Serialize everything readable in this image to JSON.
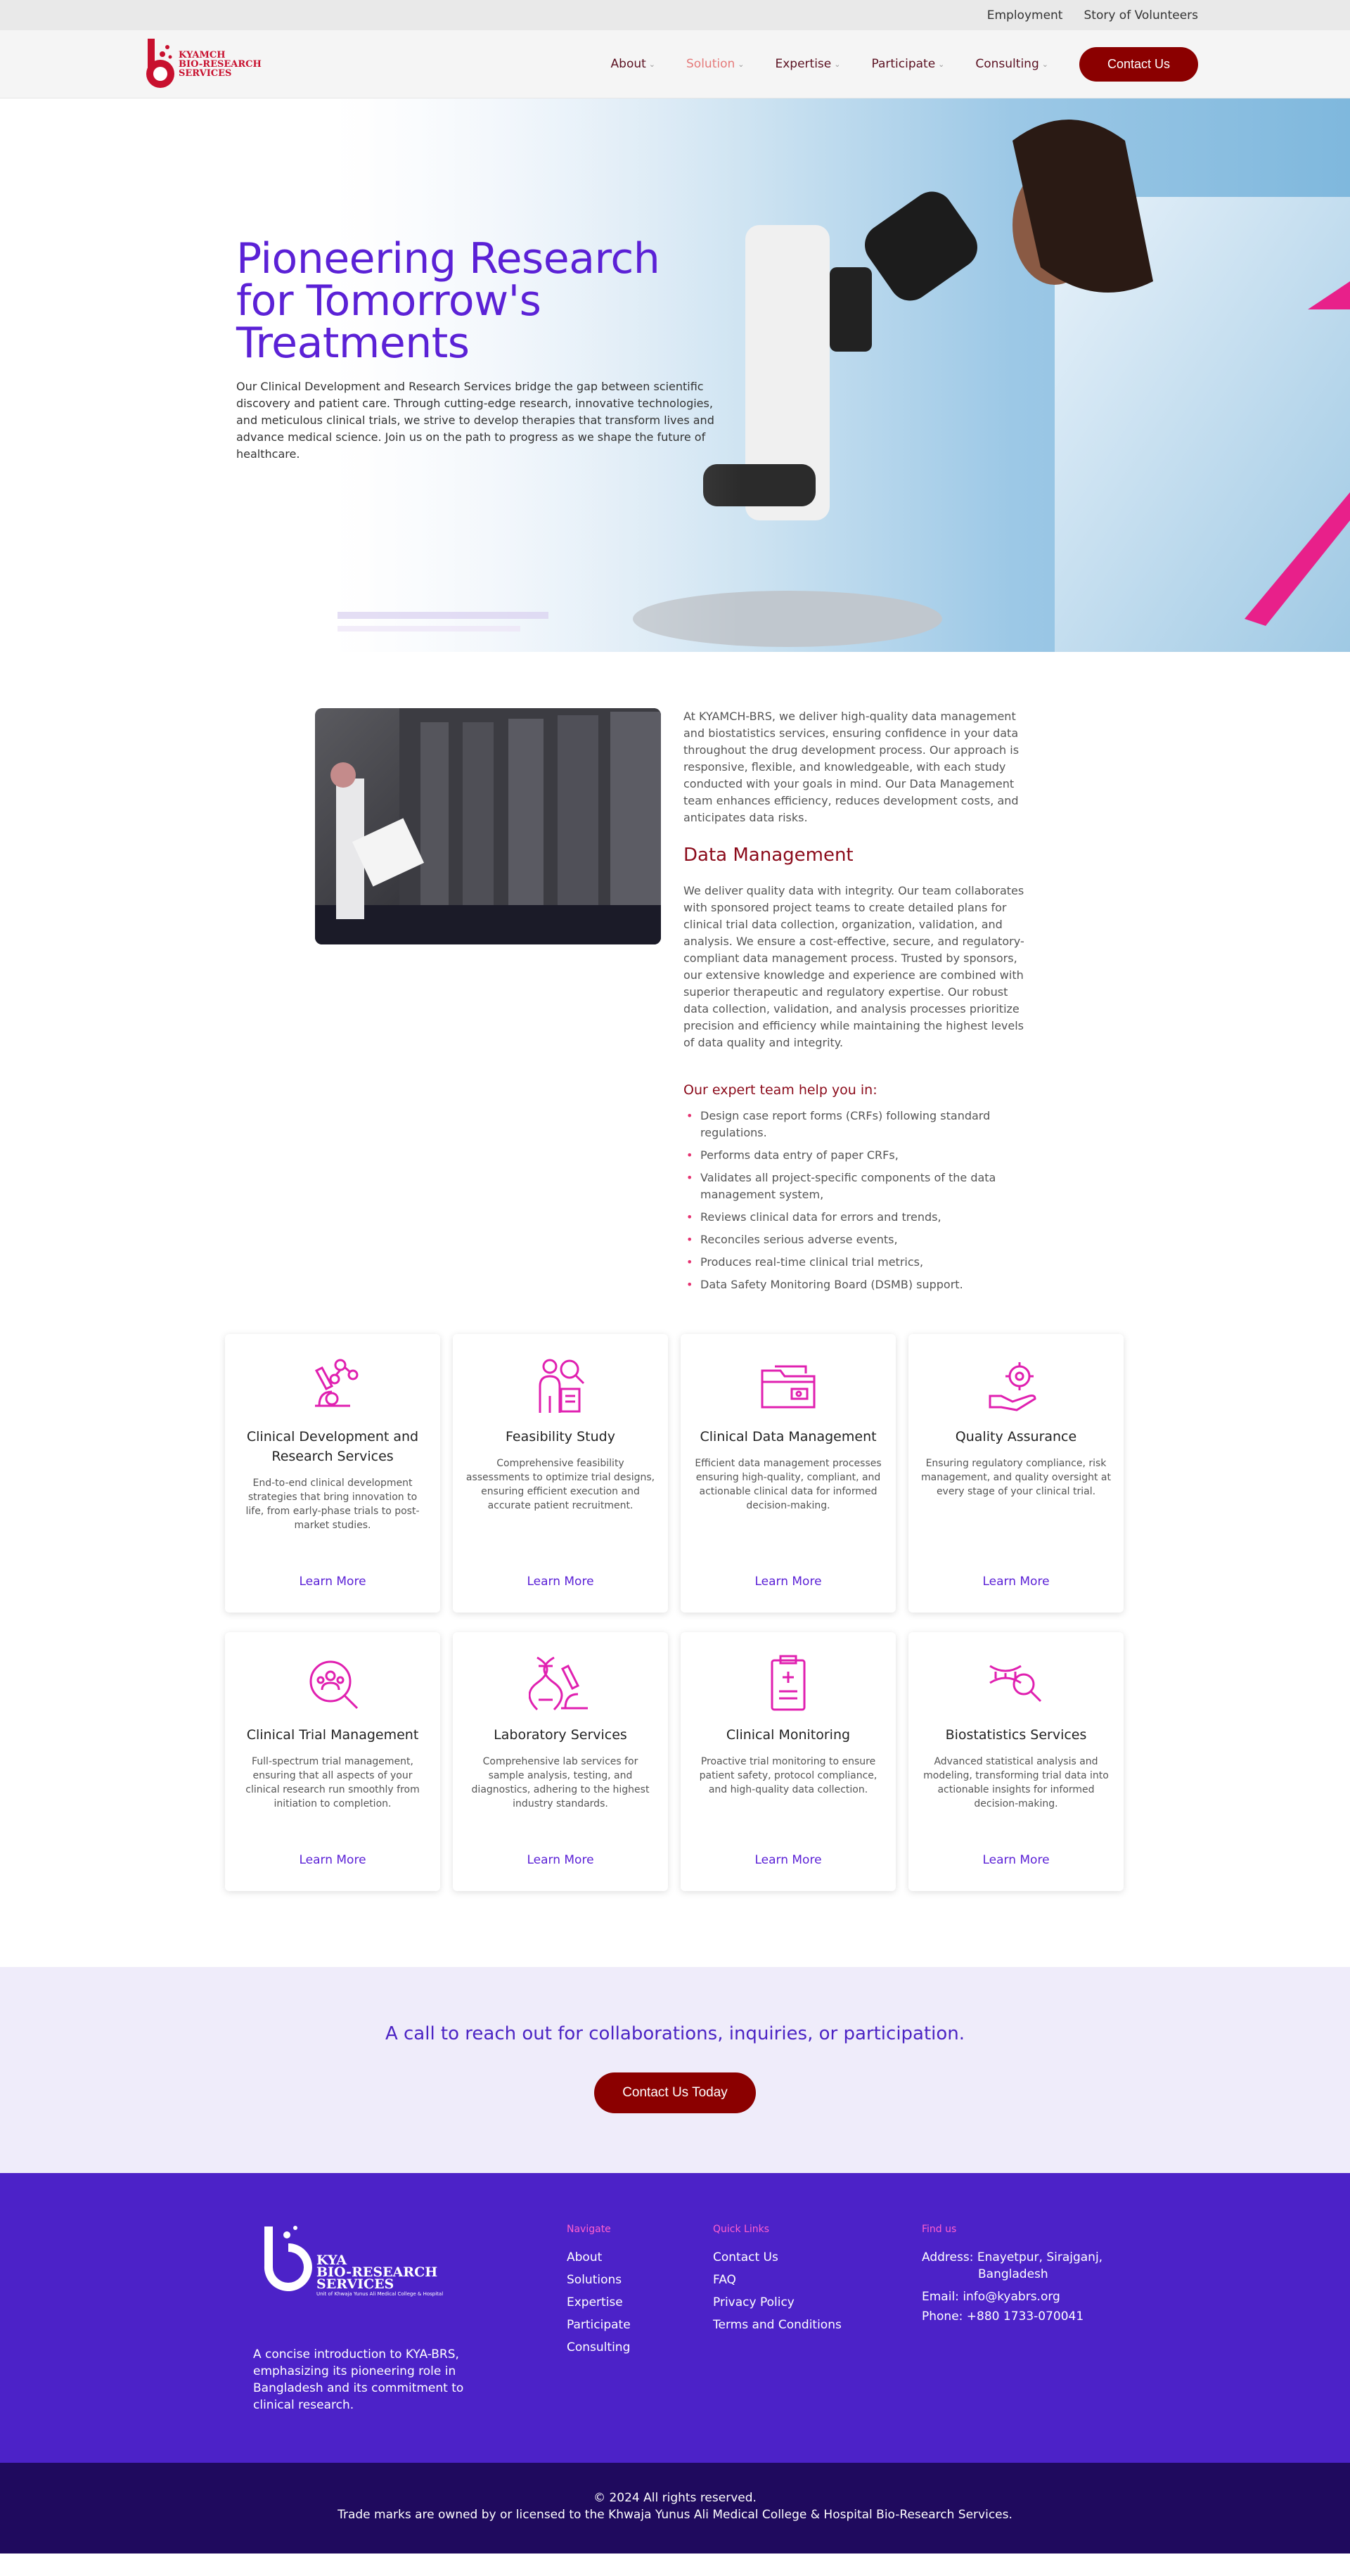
{
  "topbar": {
    "links": [
      "Employment",
      "Story of Volunteers"
    ]
  },
  "header": {
    "logo_text": [
      "KYAMCH",
      "BIO-RESEARCH",
      "SERVICES"
    ],
    "nav": [
      {
        "label": "About"
      },
      {
        "label": "Solution"
      },
      {
        "label": "Expertise"
      },
      {
        "label": "Participate"
      },
      {
        "label": "Consulting"
      }
    ],
    "contact_label": "Contact Us"
  },
  "hero": {
    "title_lines": [
      "Pioneering Research",
      "for Tomorrow's",
      "Treatments"
    ],
    "body": "Our Clinical Development and Research Services bridge the gap between scientific discovery and patient care. Through cutting-edge research, innovative technologies, and meticulous clinical trials, we strive to develop therapies that transform lives and advance medical science. Join us on the path to progress as we shape the future of healthcare."
  },
  "data_management": {
    "intro": "At KYAMCH-BRS, we deliver high-quality data management and biostatistics services, ensuring confidence in your data throughout the drug development process. Our approach is responsive, flexible, and knowledgeable, with each study conducted with your goals in mind. Our Data Management team enhances efficiency, reduces development costs, and anticipates data risks.",
    "heading": "Data Management",
    "body": "We deliver quality data with integrity. Our team collaborates with sponsored project teams to create detailed plans for clinical trial data collection, organization, validation, and analysis. We ensure a cost-effective, secure, and regulatory-compliant data management process. Trusted by sponsors, our extensive knowledge and experience are combined with superior therapeutic and regulatory expertise. Our robust data collection, validation, and analysis processes prioritize precision and efficiency while maintaining the highest levels of data quality and integrity.",
    "subheading": "Our expert team help you in:",
    "items": [
      "Design case report forms (CRFs) following standard regulations.",
      "Performs data entry of paper CRFs,",
      "Validates all project-specific components of the data management system,",
      "Reviews clinical data for errors and trends,",
      "Reconciles serious adverse events,",
      "Produces real-time clinical trial metrics,",
      "Data Safety Monitoring Board (DSMB) support."
    ]
  },
  "cards": [
    {
      "title": "Clinical Development and Research Services",
      "text": "End-to-end clinical development strategies that bring innovation to life, from early-phase trials to post-market studies.",
      "link": "Learn More",
      "icon": "molecule-microscope-icon"
    },
    {
      "title": "Feasibility Study",
      "text": "Comprehensive feasibility assessments to optimize trial designs, ensuring efficient execution and accurate patient recruitment.",
      "link": "Learn More",
      "icon": "person-analysis-icon"
    },
    {
      "title": "Clinical Data Management",
      "text": "Efficient data management processes ensuring high-quality, compliant, and actionable clinical data for informed decision-making.",
      "link": "Learn More",
      "icon": "folder-icon"
    },
    {
      "title": "Quality Assurance",
      "text": "Ensuring regulatory compliance, risk management, and quality oversight at every stage of your clinical trial.",
      "link": "Learn More",
      "icon": "hand-gear-icon"
    },
    {
      "title": "Clinical Trial Management",
      "text": "Full-spectrum trial management, ensuring that all aspects of your clinical research run smoothly from initiation to completion.",
      "link": "Learn More",
      "icon": "team-search-icon"
    },
    {
      "title": "Laboratory Services",
      "text": "Comprehensive lab services for sample analysis, testing, and diagnostics, adhering to the highest industry standards.",
      "link": "Learn More",
      "icon": "dna-microscope-icon"
    },
    {
      "title": "Clinical Monitoring",
      "text": "Proactive trial monitoring to ensure patient safety, protocol compliance, and high-quality data collection.",
      "link": "Learn More",
      "icon": "clipboard-medical-icon"
    },
    {
      "title": "Biostatistics Services",
      "text": "Advanced statistical analysis and modeling, transforming trial data into actionable insights for informed decision-making.",
      "link": "Learn More",
      "icon": "dna-search-icon"
    }
  ],
  "cta": {
    "heading": "A call to reach out for collaborations, inquiries, or participation.",
    "button": "Contact Us Today"
  },
  "footer": {
    "logo_lines": [
      "KYA",
      "BIO-RESEARCH",
      "SERVICES"
    ],
    "logo_sub": "Unit of Khwaja Yunus Ali Medical College & Hospital",
    "about": "A concise introduction to KYA-BRS, emphasizing its pioneering role in Bangladesh and its commitment to clinical research.",
    "navigate": {
      "heading": "Navigate",
      "links": [
        "About",
        "Solutions",
        "Expertise",
        "Participate",
        "Consulting"
      ]
    },
    "quick": {
      "heading": "Quick Links",
      "links": [
        "Contact Us",
        "FAQ",
        "Privacy Policy",
        "Terms and Conditions"
      ]
    },
    "find": {
      "heading": "Find us",
      "address_label": "Address:",
      "address": "Enayetpur, Sirajganj,",
      "address2": "Bangladesh",
      "email_label": "Email:",
      "email": "info@kyabrs.org",
      "phone_label": "Phone:",
      "phone": "+880 1733-070041"
    }
  },
  "bottom": {
    "line1": "© 2024  All rights reserved.",
    "line2": "Trade marks are owned by or licensed to the Khwaja Yunus Ali Medical College & Hospital Bio-Research Services."
  }
}
